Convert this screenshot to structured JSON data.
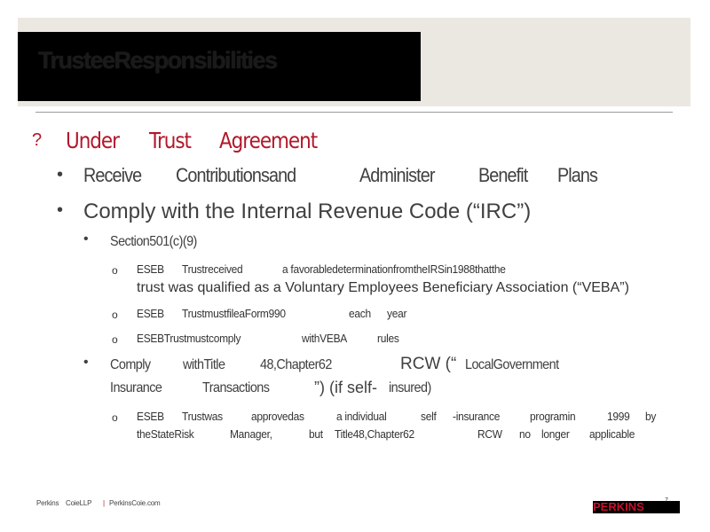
{
  "slide": {
    "title": "TrusteeResponsibilities",
    "heading": {
      "bullet": "?",
      "parts": [
        "Under",
        "Trust",
        "Agreement"
      ]
    },
    "item1": {
      "bullet": "•",
      "parts": [
        "Receive",
        "Contributionsand",
        "Administer",
        "Benefit",
        "Plans"
      ]
    },
    "item2": {
      "bullet": "•",
      "text": "Comply with the Internal Revenue Code (“IRC”)"
    },
    "sub1": {
      "bullet": "•",
      "text": "Section501(c)(9)"
    },
    "sub1_points": {
      "p1_bullet": "o",
      "p1_line1_parts": [
        "ESEB",
        "Trustreceived",
        "a favorabledeterminationfromtheIRSin1988thatthe"
      ],
      "p1_line2": "trust was qualified as a Voluntary Employees Beneficiary Association (“VEBA”)",
      "p2_bullet": "o",
      "p2_parts": [
        "ESEB",
        "TrustmustfileaForm990",
        "each",
        "year"
      ],
      "p3_bullet": "o",
      "p3_parts": [
        "ESEBTrustmustcomply",
        "withVEBA",
        "rules"
      ]
    },
    "sub2": {
      "bullet": "•",
      "line1_parts": [
        "Comply",
        "withTitle",
        "48,Chapter62",
        "RCW (“",
        "LocalGovernment"
      ],
      "line2_parts": [
        "Insurance",
        "Transactions",
        "”) (if self-",
        "insured)"
      ]
    },
    "sub2_points": {
      "p1_bullet": "o",
      "p1_line1_parts": [
        "ESEB",
        "Trustwas",
        "approvedas",
        "a individual",
        "self",
        "-insurance",
        "programin",
        "1999",
        "by"
      ],
      "p1_line2_parts": [
        "theStateRisk",
        "Manager,",
        "but",
        "Title48,Chapter62",
        "RCW",
        "no",
        "longer",
        "applicable"
      ]
    }
  },
  "footer": {
    "firm": "Perkins",
    "firm2": "CoieLLP",
    "separator": "|",
    "website": "PerkinsCoie.com",
    "logo": "PERKINS",
    "page": "7"
  }
}
